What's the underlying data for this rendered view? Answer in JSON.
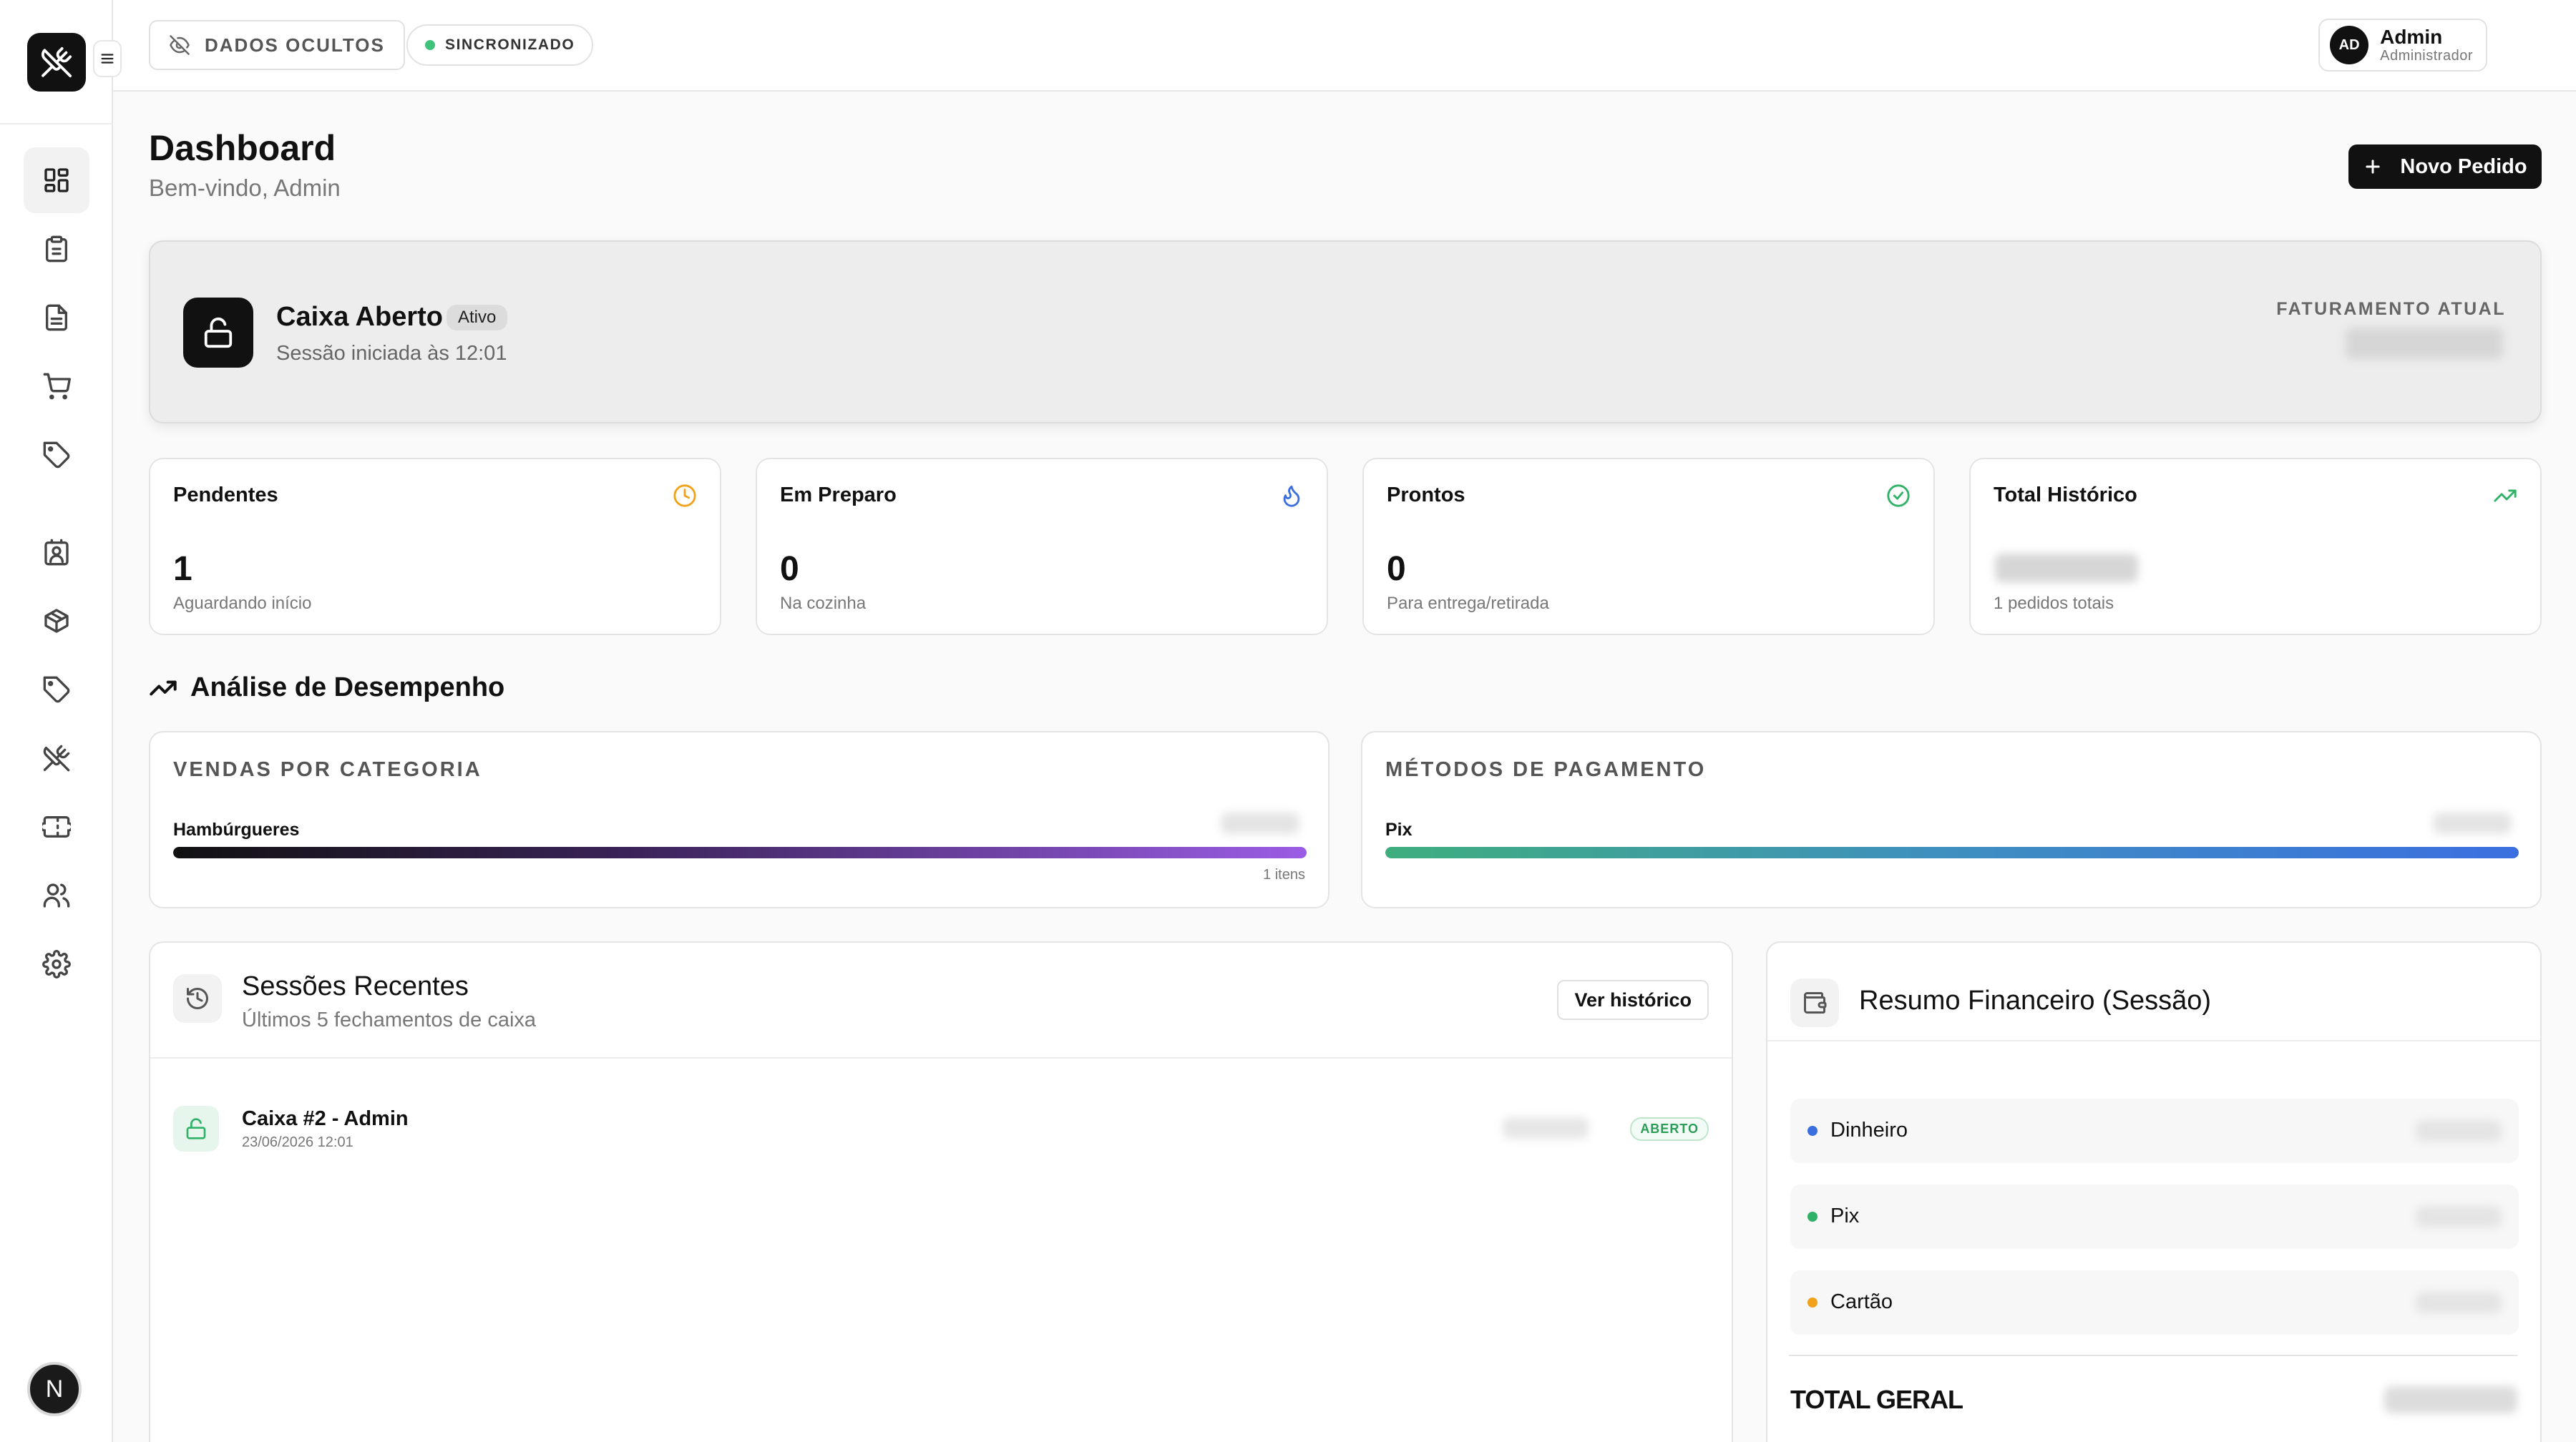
{
  "topbar": {
    "hidden_label": "DADOS OCULTOS",
    "sync_label": "SINCRONIZADO",
    "user_initials": "AD",
    "user_name": "Admin",
    "user_role": "Administrador"
  },
  "sidebar": {
    "bottom_avatar": "N"
  },
  "header": {
    "title": "Dashboard",
    "subtitle": "Bem-vindo, Admin",
    "new_order_label": "Novo Pedido"
  },
  "caixa": {
    "title": "Caixa Aberto",
    "badge": "Ativo",
    "session": "Sessão iniciada às 12:01",
    "revenue_label": "FATURAMENTO ATUAL"
  },
  "stats": [
    {
      "title": "Pendentes",
      "value": "1",
      "sub": "Aguardando início",
      "icon": "clock-icon",
      "color": "#f0a21b"
    },
    {
      "title": "Em Preparo",
      "value": "0",
      "sub": "Na cozinha",
      "icon": "flame-icon",
      "color": "#3b6fe0"
    },
    {
      "title": "Prontos",
      "value": "0",
      "sub": "Para entrega/retirada",
      "icon": "check-circle-icon",
      "color": "#2fb267"
    },
    {
      "title": "Total Histórico",
      "value": "",
      "sub": "1 pedidos totais",
      "icon": "trending-up-icon",
      "color": "#2fb267"
    }
  ],
  "performance": {
    "title": "Análise de Desempenho",
    "categories": {
      "title": "VENDAS POR CATEGORIA",
      "label": "Hambúrgueres",
      "fill": 1.0,
      "footer": "1 itens"
    },
    "payments": {
      "title": "MÉTODOS DE PAGAMENTO",
      "label": "Pix",
      "fill": 1.0
    }
  },
  "sessions": {
    "title": "Sessões Recentes",
    "subtitle": "Últimos 5 fechamentos de caixa",
    "history_button": "Ver histórico",
    "rows": [
      {
        "title": "Caixa #2 - Admin",
        "date": "23/06/2026 12:01",
        "status": "ABERTO"
      }
    ]
  },
  "finance": {
    "title": "Resumo Financeiro (Sessão)",
    "rows": [
      {
        "label": "Dinheiro",
        "color": "#3b6fe0"
      },
      {
        "label": "Pix",
        "color": "#2fb267"
      },
      {
        "label": "Cartão",
        "color": "#f0a21b"
      }
    ],
    "total_label": "TOTAL GERAL"
  }
}
